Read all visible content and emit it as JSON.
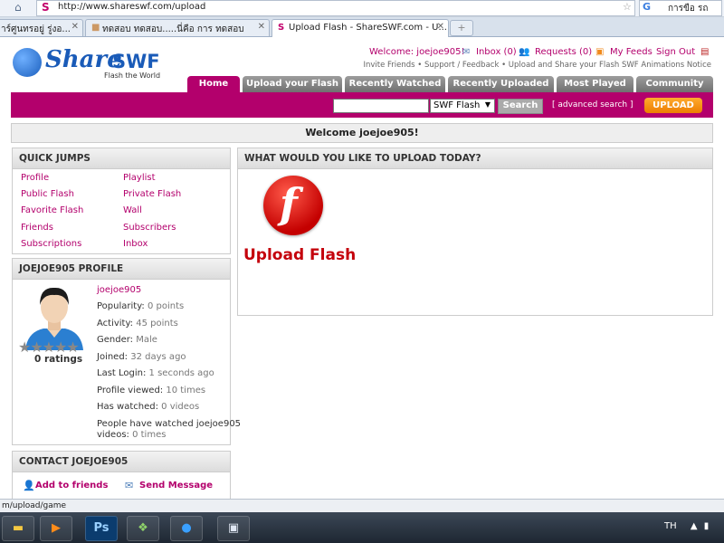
{
  "browser": {
    "url": "http://www.shareswf.com/upload",
    "search_engine_text": "การขือ รถ",
    "tabs": [
      {
        "label": "าร์ศูนทรอยู่ รู่งอ..."
      },
      {
        "label": "ทดสอบ ทดสอบ.....นี่คือ การ ทดสอบ"
      },
      {
        "label": "Upload Flash - ShareSWF.com - U..."
      }
    ],
    "status_text": "m/upload/game"
  },
  "logo": {
    "brand_share": "Share",
    "brand_swf": "SWF",
    "tagline": "Flash the World"
  },
  "userbar": {
    "welcome": "Welcome: joejoe905!",
    "inbox": "Inbox (0)",
    "requests": "Requests (0)",
    "feeds": "My Feeds",
    "signout": "Sign Out",
    "tagline": "Invite Friends • Support / Feedback • Upload and Share your Flash SWF Animations Notice"
  },
  "nav": {
    "tabs": [
      {
        "label": "Home"
      },
      {
        "label": "Upload your Flash"
      },
      {
        "label": "Recently Watched"
      },
      {
        "label": "Recently Uploaded"
      },
      {
        "label": "Most Played"
      },
      {
        "label": "Community"
      }
    ]
  },
  "search": {
    "query": "",
    "type": "SWF Flash",
    "button": "Search",
    "advanced": "[ advanced search ]",
    "upload": "UPLOAD"
  },
  "welcome_bar": "Welcome joejoe905!",
  "quick_jumps": {
    "title": "QUICK JUMPS",
    "left": [
      "Profile",
      "Public Flash",
      "Favorite Flash",
      "Friends",
      "Subscriptions"
    ],
    "right": [
      "Playlist",
      "Private Flash",
      "Wall",
      "Subscribers",
      "Inbox"
    ]
  },
  "profile": {
    "title": "JOEJOE905 PROFILE",
    "username": "joejoe905",
    "stats": [
      {
        "label": "Popularity:",
        "value": "0 points"
      },
      {
        "label": "Activity:",
        "value": "45 points"
      },
      {
        "label": "Gender:",
        "value": "Male"
      },
      {
        "label": "Joined:",
        "value": "32 days ago"
      },
      {
        "label": "Last Login:",
        "value": "1 seconds ago"
      },
      {
        "label": "Profile viewed:",
        "value": "10 times"
      },
      {
        "label": "Has watched:",
        "value": "0 videos"
      }
    ],
    "watched_line1": "People have watched joejoe905",
    "watched_line2_label": "videos:",
    "watched_line2_value": "0 times",
    "rating_stars": 0,
    "ratings_text": "0 ratings"
  },
  "contact": {
    "title": "CONTACT JOEJOE905",
    "add_friend": "Add to friends",
    "send_message": "Send Message"
  },
  "upload_panel": {
    "title": "WHAT WOULD YOU LIKE TO UPLOAD TODAY?",
    "flash_label": "Upload Flash"
  },
  "taskbar": {
    "lang": "TH"
  },
  "colors": {
    "brand": "#b3006c",
    "logo_blue": "#1a5bb8",
    "upload_orange": "#ec7d00",
    "flash_red": "#c4000b"
  }
}
